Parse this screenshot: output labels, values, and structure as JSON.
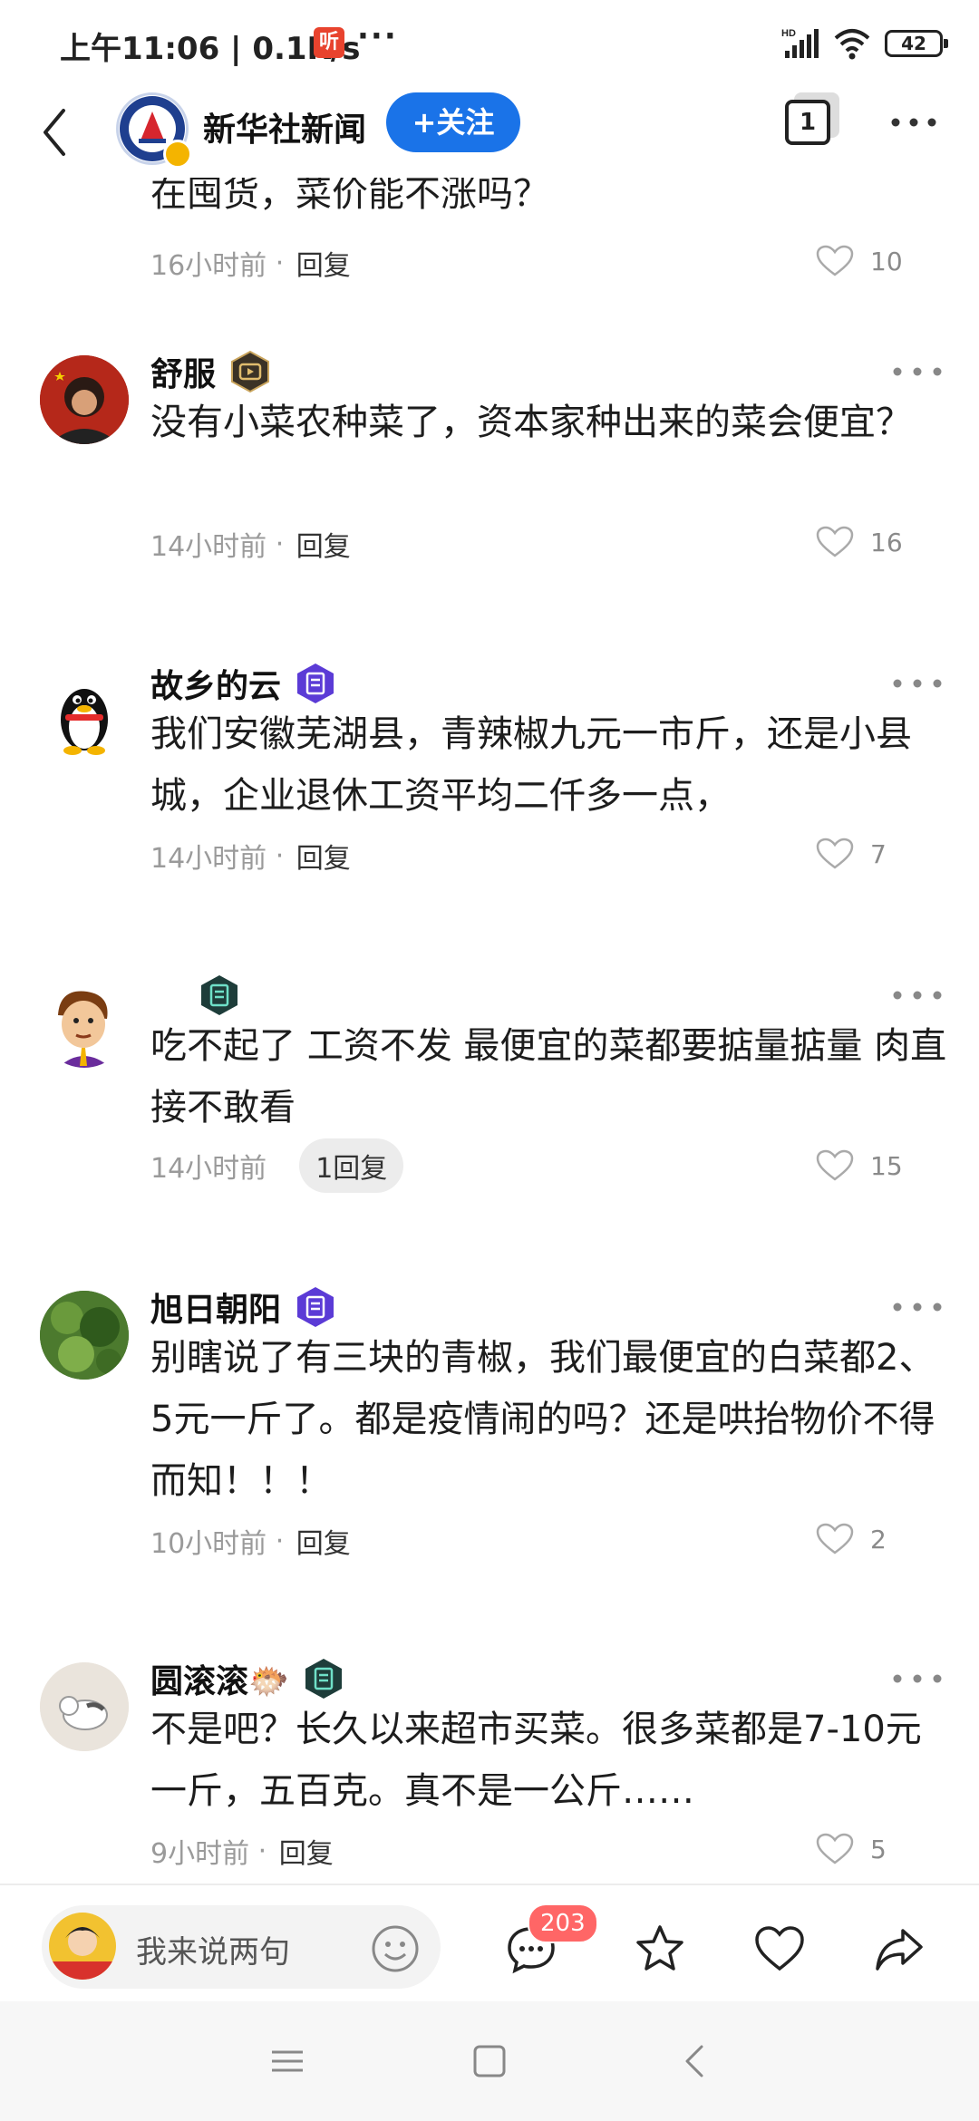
{
  "status_bar": {
    "time_speed": "上午11:06 | 0.1K/s",
    "listen_icon_text": "听",
    "dots": "···",
    "battery": "42"
  },
  "header": {
    "account_name": "新华社新闻",
    "follow_label": "+关注",
    "window_count": "1"
  },
  "comments": [
    {
      "name": "",
      "text": "在囤货，菜价能不涨吗？",
      "time": "16小时前",
      "reply": "回复",
      "likes": "10"
    },
    {
      "name": "舒服",
      "text": "没有小菜农种菜了，资本家种出来的菜会便宜？",
      "time": "14小时前",
      "reply": "回复",
      "likes": "16"
    },
    {
      "name": "故乡的云",
      "text": "我们安徽芜湖县，青辣椒九元一市斤，还是小县城，企业退休工资平均二仟多一点，",
      "time": "14小时前",
      "reply": "回复",
      "likes": "7"
    },
    {
      "name": "",
      "text": "吃不起了 工资不发 最便宜的菜都要掂量掂量 肉直接不敢看",
      "time": "14小时前",
      "reply_pill": "1回复",
      "likes": "15"
    },
    {
      "name": "旭日朝阳",
      "text": "别瞎说了有三块的青椒，我们最便宜的白菜都2、5元一斤了。都是疫情闹的吗？还是哄抬物价不得而知！！！",
      "time": "10小时前",
      "reply": "回复",
      "likes": "2"
    },
    {
      "name": "圆滚滚🐡",
      "text": "不是吧？长久以来超市买菜。很多菜都是7-10元一斤，五百克。真不是一公斤……",
      "time": "9小时前",
      "reply": "回复",
      "likes": "5"
    }
  ],
  "bottom_bar": {
    "input_placeholder": "我来说两句",
    "comment_count": "203"
  },
  "colors": {
    "accent_blue": "#1a73e8",
    "badge_red": "#ff6666",
    "meta_gray": "#9a9a9a"
  }
}
